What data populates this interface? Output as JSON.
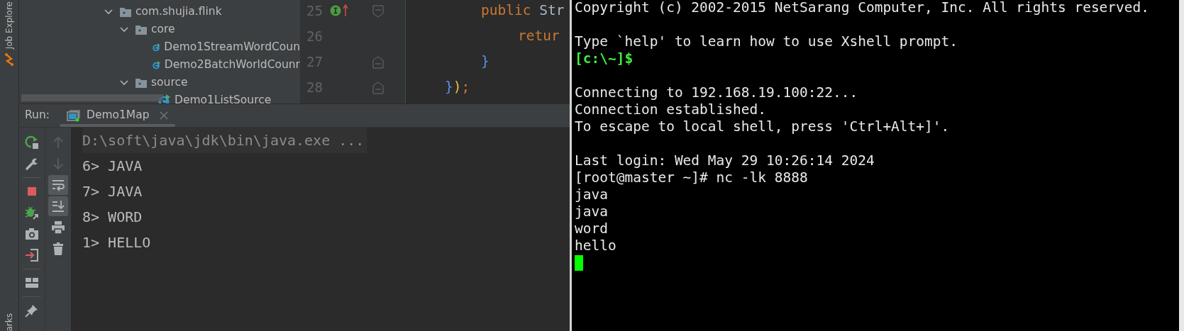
{
  "left_strip": {
    "top_label": "Job Explore",
    "bottom_label": "arks"
  },
  "project_tree": {
    "items": [
      {
        "label": "com.shujia.flink",
        "kind": "package",
        "expanded": true,
        "children": [
          {
            "label": "core",
            "kind": "package",
            "expanded": true,
            "children": [
              {
                "label": "Demo1StreamWordCoun",
                "kind": "class"
              },
              {
                "label": "Demo2BatchWorldCounr",
                "kind": "class"
              }
            ]
          },
          {
            "label": "source",
            "kind": "package",
            "expanded": true,
            "children": [
              {
                "label": "Demo1ListSource",
                "kind": "class"
              }
            ]
          }
        ]
      }
    ]
  },
  "editor": {
    "lines": [
      {
        "number": "25",
        "implemented_marker": true,
        "override_marker": true,
        "fold_start": true,
        "tokens": [
          {
            "text": "public",
            "kind": "keyword"
          },
          {
            "text": "Str",
            "kind": "type"
          }
        ]
      },
      {
        "number": "26",
        "tokens": [
          {
            "text": "retur",
            "kind": "keyword"
          }
        ]
      },
      {
        "number": "27",
        "fold_end": true,
        "tokens": [
          {
            "text": "}",
            "kind": "brace"
          }
        ]
      },
      {
        "number": "28",
        "fold_end": true,
        "tokens": [
          {
            "text": "}",
            "kind": "brace"
          },
          {
            "text": ")",
            "kind": "paren"
          },
          {
            "text": ";",
            "kind": "punct"
          }
        ]
      }
    ]
  },
  "run_panel": {
    "label": "Run:",
    "tabs": [
      {
        "label": "Demo1Map",
        "selected": true
      }
    ],
    "toolbar": [
      {
        "kind": "rerun"
      },
      {
        "kind": "settings"
      },
      {
        "kind": "separator"
      },
      {
        "kind": "stop"
      },
      {
        "kind": "debug"
      },
      {
        "kind": "screenshot"
      },
      {
        "kind": "exit"
      },
      {
        "kind": "separator"
      },
      {
        "kind": "layout"
      },
      {
        "kind": "separator"
      },
      {
        "kind": "pin"
      }
    ],
    "side_toolbar": [
      {
        "kind": "up",
        "disabled": true,
        "selected": false
      },
      {
        "kind": "down",
        "disabled": true,
        "selected": false
      },
      {
        "kind": "wrap",
        "disabled": false,
        "selected": true
      },
      {
        "kind": "scroll_end",
        "disabled": false,
        "selected": true
      },
      {
        "kind": "print",
        "disabled": false,
        "selected": false
      },
      {
        "kind": "trash",
        "disabled": false,
        "selected": false
      }
    ],
    "console": [
      {
        "text": "D:\\soft\\java\\jdk\\bin\\java.exe ...",
        "kind": "command"
      },
      {
        "text": "6> JAVA",
        "kind": "output"
      },
      {
        "text": "7> JAVA",
        "kind": "output"
      },
      {
        "text": "8> WORD",
        "kind": "output"
      },
      {
        "text": "1> HELLO",
        "kind": "output"
      }
    ]
  },
  "terminal": {
    "cursor": true,
    "lines": [
      {
        "kind": "plain",
        "text": "Copyright (c) 2002-2015 NetSarang Computer, Inc. All rights reserved."
      },
      {
        "kind": "blank"
      },
      {
        "kind": "plain",
        "text": "Type `help' to learn how to use Xshell prompt."
      },
      {
        "kind": "prompt",
        "text": "[c:\\~]$"
      },
      {
        "kind": "blank"
      },
      {
        "kind": "plain",
        "text": "Connecting to 192.168.19.100:22..."
      },
      {
        "kind": "plain",
        "text": "Connection established."
      },
      {
        "kind": "plain",
        "text": "To escape to local shell, press 'Ctrl+Alt+]'."
      },
      {
        "kind": "blank"
      },
      {
        "kind": "plain",
        "text": "Last login: Wed May 29 10:26:14 2024"
      },
      {
        "kind": "plain",
        "text": "[root@master ~]# nc -lk 8888"
      },
      {
        "kind": "plain",
        "text": "java"
      },
      {
        "kind": "plain",
        "text": "java"
      },
      {
        "kind": "plain",
        "text": "word"
      },
      {
        "kind": "plain",
        "text": "hello"
      }
    ]
  }
}
